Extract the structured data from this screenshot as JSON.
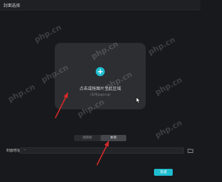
{
  "window": {
    "title": "封面选择"
  },
  "dropzone": {
    "prompt": "点击或拖图片至此区域",
    "hint": "(支持jpg/png)",
    "plus_symbol": "+",
    "icon": "plus-icon"
  },
  "tabs": [
    {
      "label": "视频帧",
      "active": false
    },
    {
      "label": "本地",
      "active": true
    }
  ],
  "cover_path": {
    "label": "封面地址",
    "value": "--"
  },
  "buttons": {
    "confirm_label": "完成",
    "folder_icon": "folder-icon"
  },
  "watermarks": [
    "php.cn",
    "php.cn",
    "php.cn",
    "php.cn",
    "php.cn",
    "php.cn",
    "php.cn",
    "php.cn",
    "php.cn"
  ],
  "colors": {
    "accent": "#1fbdd0",
    "background": "#18191c",
    "panel": "#2d2e32",
    "annotation_arrow": "#d62a2a"
  }
}
